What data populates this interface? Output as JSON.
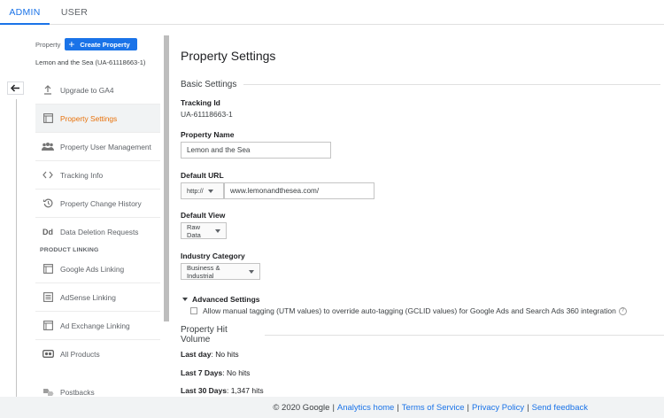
{
  "tabs": {
    "admin": "ADMIN",
    "user": "USER"
  },
  "property": {
    "label": "Property",
    "create_label": "Create Property",
    "current": "Lemon and the Sea (UA-61118663-1)"
  },
  "nav": {
    "upgrade": "Upgrade to GA4",
    "settings": "Property Settings",
    "user_mgmt": "Property User Management",
    "tracking": "Tracking Info",
    "history": "Property Change History",
    "deletion": "Data Deletion Requests",
    "product_linking": "PRODUCT LINKING",
    "google_ads": "Google Ads Linking",
    "adsense": "AdSense Linking",
    "ad_exchange": "Ad Exchange Linking",
    "all_products": "All Products",
    "postbacks": "Postbacks"
  },
  "main": {
    "title": "Property Settings",
    "basic_settings": "Basic Settings",
    "tracking_id_label": "Tracking Id",
    "tracking_id": "UA-61118663-1",
    "property_name_label": "Property Name",
    "property_name": "Lemon and the Sea",
    "default_url_label": "Default URL",
    "protocol": "http://",
    "url": "www.lemonandthesea.com/",
    "default_view_label": "Default View",
    "default_view": "Raw Data",
    "industry_label": "Industry Category",
    "industry": "Business & Industrial",
    "advanced_settings": "Advanced Settings",
    "manual_tagging": "Allow manual tagging (UTM values) to override auto-tagging (GCLID values) for Google Ads and Search Ads 360 integration",
    "help_glyph": "?",
    "hit_volume": "Property Hit Volume",
    "last_day_label": "Last day",
    "last_day": ": No hits",
    "last_7_label": "Last 7 Days",
    "last_7": ": No hits",
    "last_30_label": "Last 30 Days",
    "last_30": ": 1,347 hits"
  },
  "footer": {
    "copyright": "© 2020 Google",
    "analytics_home": "Analytics home",
    "terms": "Terms of Service",
    "privacy": "Privacy Policy",
    "feedback": "Send feedback",
    "sep": "|"
  },
  "colors": {
    "accent": "#1a73e8",
    "active": "#e8710a"
  },
  "icons": {
    "upgrade": "upload-arrow-icon",
    "settings": "window-icon",
    "user_mgmt": "people-icon",
    "tracking": "code-brackets-icon",
    "history": "history-icon",
    "deletion": "dd-icon",
    "google_ads": "window-icon",
    "adsense": "list-icon",
    "ad_exchange": "window-icon",
    "all_products": "link-icon",
    "postbacks": "postback-icon",
    "back": "back-arrow-icon"
  }
}
